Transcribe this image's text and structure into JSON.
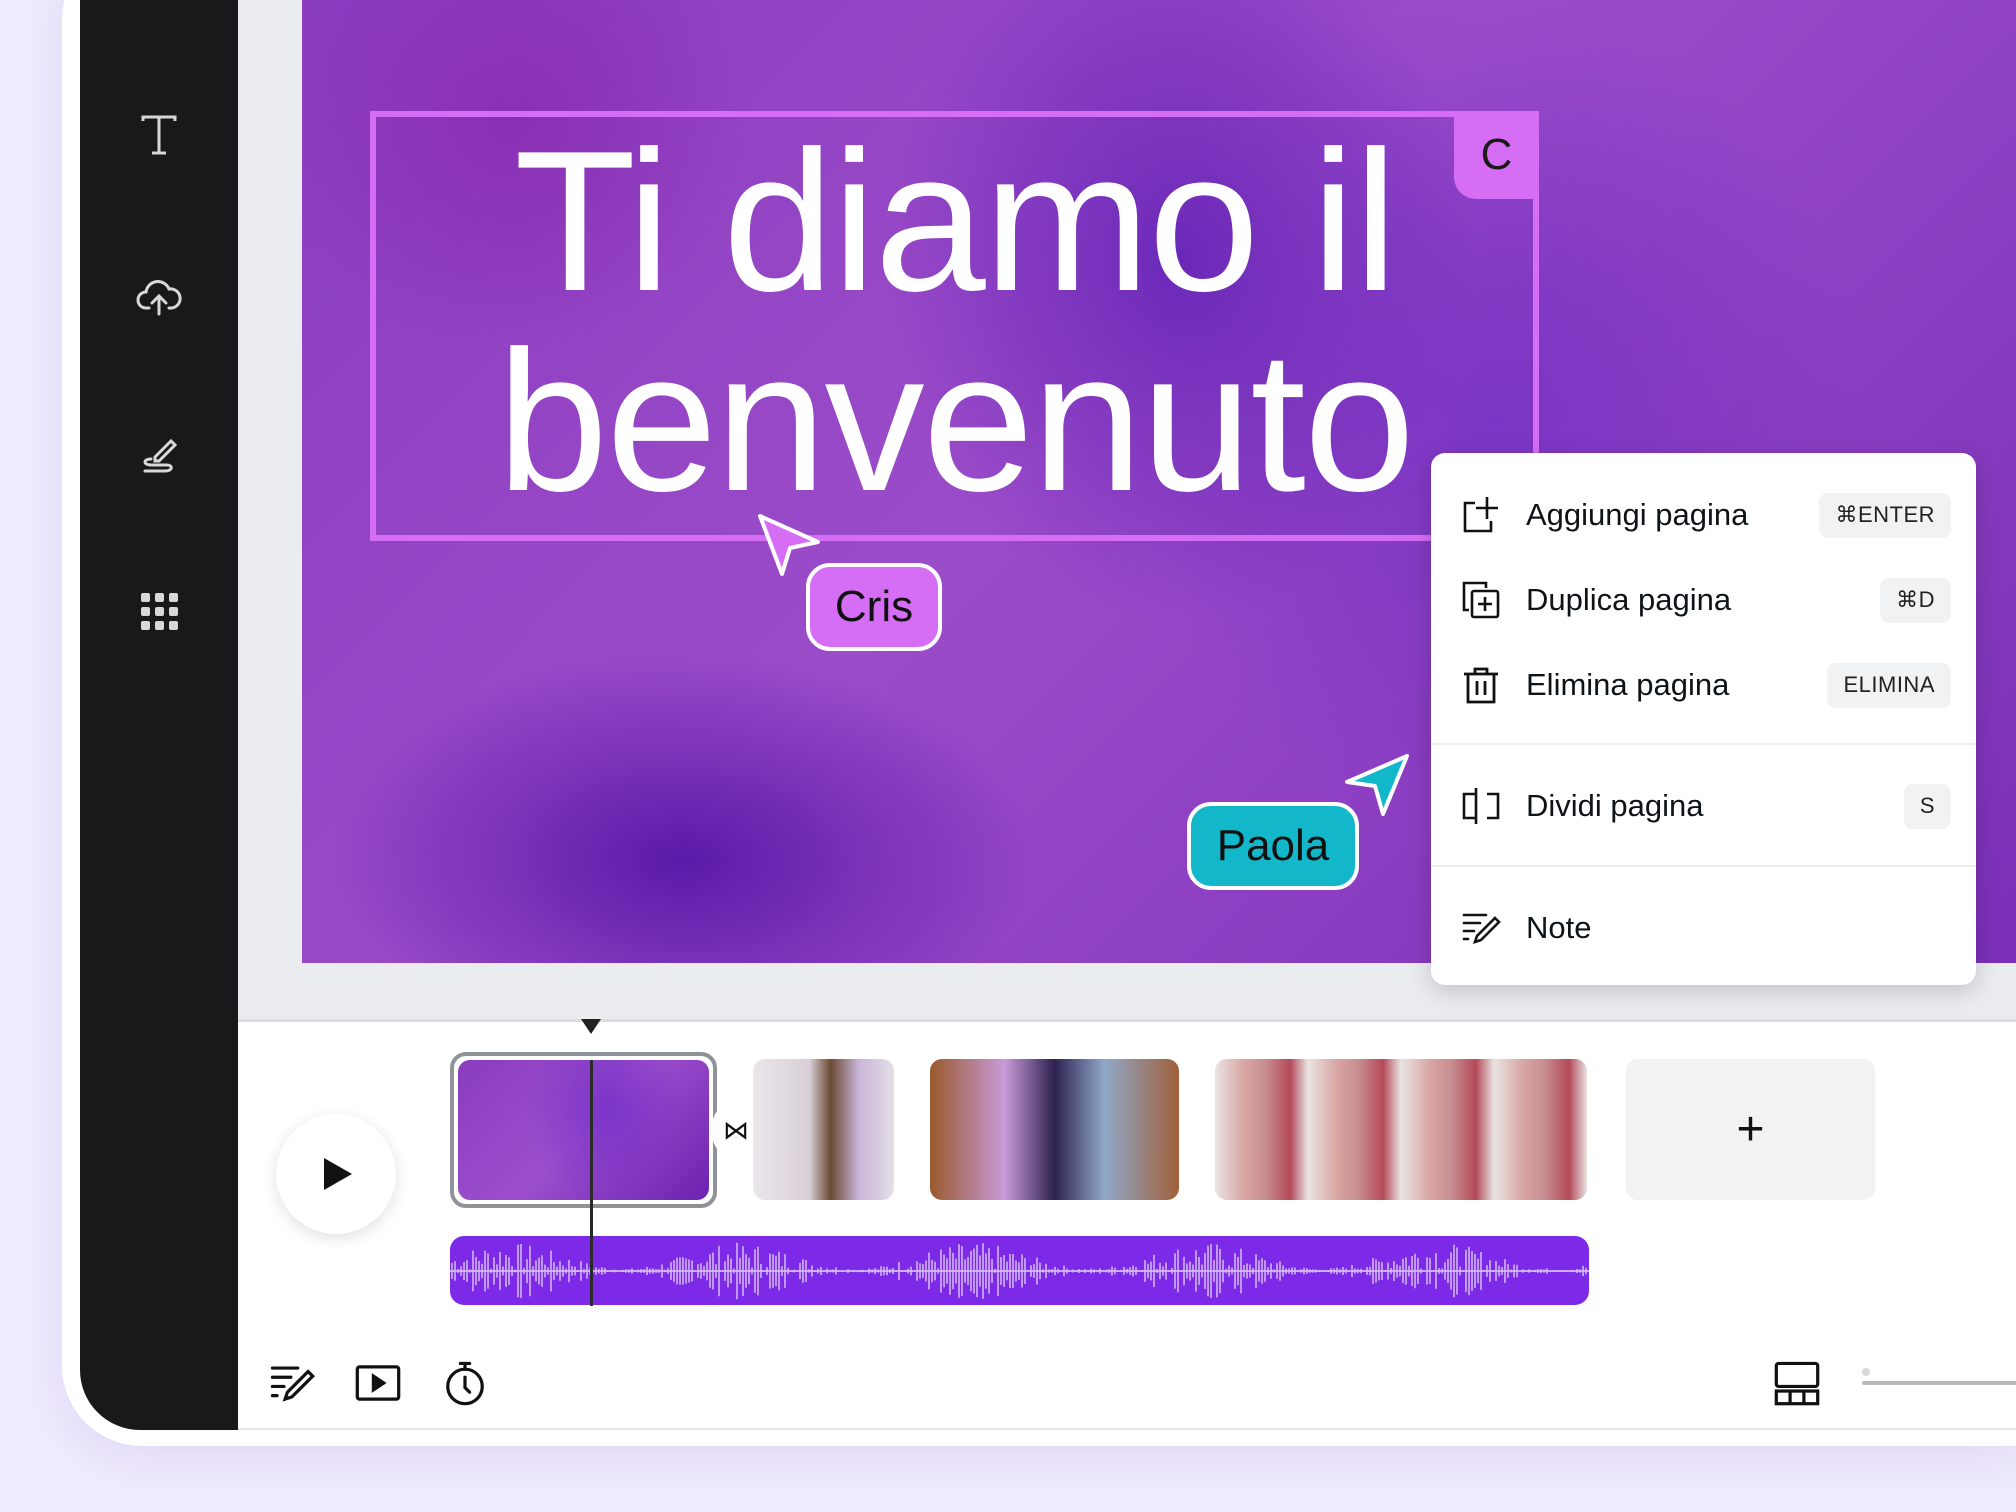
{
  "sidebar": {
    "items": [
      {
        "icon": "text-icon"
      },
      {
        "icon": "upload-cloud-icon"
      },
      {
        "icon": "draw-icon"
      },
      {
        "icon": "apps-grid-icon"
      }
    ]
  },
  "design": {
    "headline_line1": "Ti diamo il",
    "headline_line2": "benvenuto",
    "collaborator_tag": "C",
    "accent": "#d66ef5"
  },
  "cursors": [
    {
      "name": "Cris",
      "color": "#d66ef5"
    },
    {
      "name": "Paola",
      "color": "#12b8c9"
    }
  ],
  "context_menu": {
    "items": [
      {
        "icon": "add-page-icon",
        "label": "Aggiungi pagina",
        "shortcut": "⌘ENTER"
      },
      {
        "icon": "duplicate-page-icon",
        "label": "Duplica pagina",
        "shortcut": "⌘D"
      },
      {
        "icon": "trash-icon",
        "label": "Elimina pagina",
        "shortcut": "ELIMINA"
      },
      {
        "icon": "split-page-icon",
        "label": "Dividi pagina",
        "shortcut": "S"
      },
      {
        "icon": "notes-icon",
        "label": "Note",
        "shortcut": ""
      }
    ]
  },
  "timeline": {
    "add_page_label": "+",
    "audio_color": "#7d2ae8"
  },
  "footer": {
    "icons": [
      "notes-icon",
      "present-icon",
      "timer-icon",
      "grid-view-icon"
    ]
  }
}
